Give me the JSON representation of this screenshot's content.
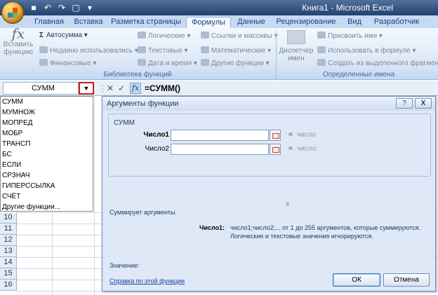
{
  "window": {
    "title": "Книга1 - Microsoft Excel"
  },
  "ribbon_tabs": [
    {
      "label": "Главная",
      "active": false
    },
    {
      "label": "Вставка",
      "active": false
    },
    {
      "label": "Разметка страницы",
      "active": false
    },
    {
      "label": "Формулы",
      "active": true
    },
    {
      "label": "Данные",
      "active": false
    },
    {
      "label": "Рецензирование",
      "active": false
    },
    {
      "label": "Вид",
      "active": false
    },
    {
      "label": "Разработчик",
      "active": false
    }
  ],
  "ribbon": {
    "insert_function": "Вставить функцию",
    "autosum": "Автосумма",
    "recent": "Недавно использовались",
    "financial": "Финансовые",
    "logical": "Логические",
    "text": "Текстовые",
    "datetime": "Дата и время",
    "lookup": "Ссылки и массивы",
    "math": "Математические",
    "other": "Другие функции",
    "library_label": "Библиотека функций",
    "name_manager": "Диспетчер имен",
    "assign_name": "Присвоить имя",
    "use_in_formula": "Использовать в формуле",
    "create_from_selection": "Создать из выделенного фрагмента",
    "names_label": "Определенные имена"
  },
  "formula_bar": {
    "name_box": "СУММ",
    "formula": "=СУММ()"
  },
  "function_list": [
    "СУММ",
    "МУМНОЖ",
    "МОПРЕД",
    "МОБР",
    "ТРАНСП",
    "БС",
    "ЕСЛИ",
    "СРЗНАЧ",
    "ГИПЕРССЫЛКА",
    "СЧЁТ",
    "Другие функции..."
  ],
  "rows": [
    "10",
    "11",
    "12",
    "13",
    "14",
    "15",
    "16"
  ],
  "dialog": {
    "title": "Аргументы функции",
    "help_btn": "?",
    "close_btn": "X",
    "function_name": "СУММ",
    "args": [
      {
        "label": "Число1",
        "value": "",
        "result": "число",
        "bold": true
      },
      {
        "label": "Число2",
        "value": "",
        "result": "число",
        "bold": false
      }
    ],
    "eq": "=",
    "total_eq": "=",
    "description": "Суммирует аргументы.",
    "arg_name": "Число1:",
    "arg_desc_1": "число1;число2;... от 1 до 255 аргументов, которые суммируются.",
    "arg_desc_2": "Логические и текстовые значения игнорируются.",
    "value_label": "Значение:",
    "help_link": "Справка по этой функции",
    "ok": "ОК",
    "cancel": "Отмена"
  }
}
